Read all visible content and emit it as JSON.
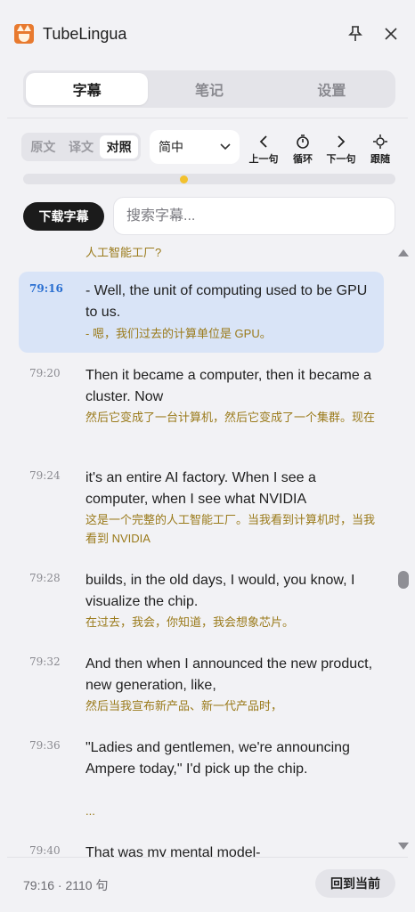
{
  "app": {
    "title": "TubeLingua"
  },
  "tabs": [
    {
      "label": "字幕",
      "active": true
    },
    {
      "label": "笔记",
      "active": false
    },
    {
      "label": "设置",
      "active": false
    }
  ],
  "toolbar": {
    "modes": [
      {
        "label": "原文",
        "active": false
      },
      {
        "label": "译文",
        "active": false
      },
      {
        "label": "对照",
        "active": true
      }
    ],
    "language": {
      "selected": "简中"
    },
    "controls": [
      {
        "label": "上一句",
        "icon": "chevron-left-icon"
      },
      {
        "label": "循环",
        "icon": "timer-icon"
      },
      {
        "label": "下一句",
        "icon": "chevron-right-icon"
      },
      {
        "label": "跟随",
        "icon": "crosshair-icon"
      }
    ]
  },
  "progress": {
    "fraction": 0.43,
    "thumb_color": "#f2c12e"
  },
  "download_button": {
    "label": "下载字幕"
  },
  "search": {
    "placeholder": "搜索字幕...",
    "value": ""
  },
  "subtitles": {
    "previous_tail": "人工智能工厂?",
    "cues": [
      {
        "time": "79:16",
        "original": "- Well, the unit of computing used to be GPU to us.",
        "translation": "- 嗯，我们过去的计算单位是 GPU。",
        "active": true
      },
      {
        "time": "79:20",
        "original": "Then it became a computer, then it became a cluster. Now",
        "translation": "然后它变成了一台计算机，然后它变成了一个集群。现在",
        "active": false
      },
      {
        "time": "79:24",
        "original": "it's an entire AI factory. When I see a computer, when I see what NVIDIA",
        "translation": "这是一个完整的人工智能工厂。当我看到计算机时，当我看到 NVIDIA",
        "active": false
      },
      {
        "time": "79:28",
        "original": "builds, in the old days, I would, you know, I visualize the chip.",
        "translation": "在过去，我会，你知道，我会想象芯片。",
        "active": false
      },
      {
        "time": "79:32",
        "original": "And then when I announced the new product, new generation, like,",
        "translation": "然后当我宣布新产品、新一代产品时，",
        "active": false
      },
      {
        "time": "79:36",
        "original": "\"Ladies and gentlemen, we're announcing Ampere today,\" I'd pick up the chip.",
        "translation": "...",
        "active": false
      },
      {
        "time": "79:40",
        "original": "That was my mental model-",
        "translation": "",
        "active": false
      }
    ]
  },
  "status": {
    "text": "79:16 · 2110 句"
  },
  "back_button": {
    "label": "回到当前"
  },
  "colors": {
    "accent_blue": "#2a6fd1",
    "translation_gold": "#9a7a1a",
    "active_row": "#d9e4f7"
  }
}
